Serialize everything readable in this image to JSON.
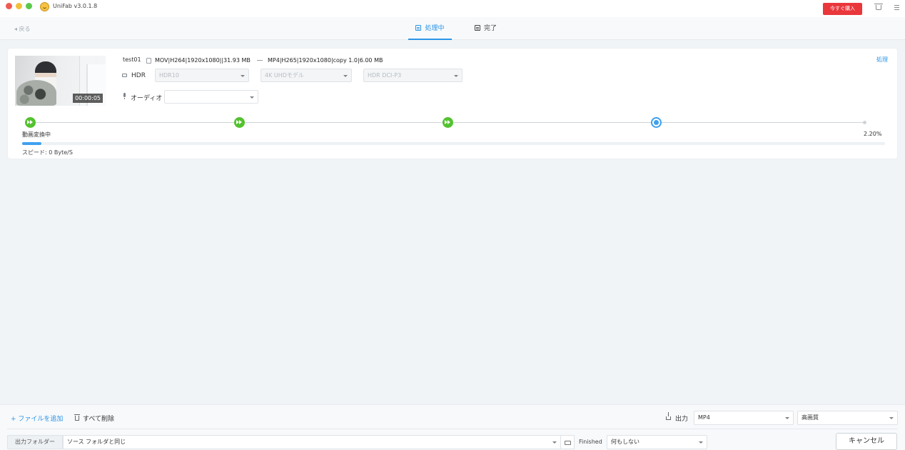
{
  "window": {
    "title": "UniFab v3.0.1.8",
    "buy_label": "今すぐ購入"
  },
  "nav": {
    "back_label": "◂ 戻る",
    "tab_processing": "処理中",
    "tab_done": "完了"
  },
  "task": {
    "name": "test01",
    "duration": "00:00:05",
    "source_info": "MOV|H264|1920x1080||31.93 MB",
    "output_info": "MP4|H265|1920x1080|copy 1.0|6.00 MB",
    "process_link": "処理",
    "hdr_label": "HDR",
    "hdr_options": [
      "HDR10",
      "4K UHDモデル",
      "HDR DCI-P3"
    ],
    "audio_label": "オーディオ",
    "audio_value": "",
    "stage_label": "動画変換中",
    "percent_label": "2.20%",
    "progress_fraction": 0.022,
    "speed_label": "スピード: 0 Byte/S"
  },
  "bottom": {
    "add_file_label": "+ ファイルを追加",
    "delete_all_label": "すべて削除",
    "output_label": "出力",
    "format_value": "MP4",
    "quality_value": "高画質",
    "folder_label": "出力フォルダー",
    "folder_value": "ソース フォルダと同じ",
    "finished_label": "Finished",
    "finished_value": "何もしない",
    "cancel_label": "キャンセル"
  },
  "colors": {
    "accent": "#2d95e6",
    "success": "#53c22f",
    "buy": "#e9373c"
  },
  "icons": [
    "app-logo-icon",
    "cart-icon",
    "menu-icon",
    "processing-icon",
    "done-icon",
    "file-icon",
    "arrow-icon",
    "monitor-icon",
    "microphone-icon",
    "step-complete-icon",
    "trash-icon",
    "upload-icon",
    "folder-icon"
  ]
}
